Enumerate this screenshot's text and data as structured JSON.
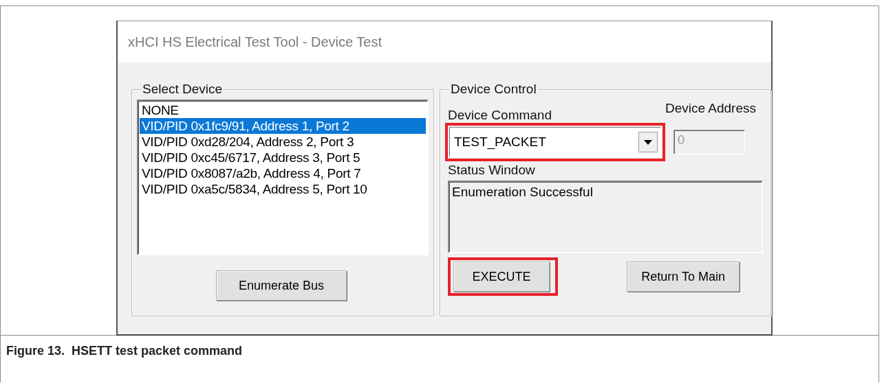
{
  "window": {
    "title": "xHCI HS Electrical Test Tool - Device Test"
  },
  "select_device": {
    "label": "Select Device",
    "items": [
      {
        "label": "NONE",
        "selected": false
      },
      {
        "label": "VID/PID 0x1fc9/91, Address 1, Port 2",
        "selected": true
      },
      {
        "label": "VID/PID 0xd28/204, Address 2, Port 3",
        "selected": false
      },
      {
        "label": "VID/PID 0xc45/6717, Address 3, Port 5",
        "selected": false
      },
      {
        "label": "VID/PID 0x8087/a2b, Address 4, Port 7",
        "selected": false
      },
      {
        "label": "VID/PID 0xa5c/5834, Address 5, Port 10",
        "selected": false
      }
    ],
    "button": {
      "label": "Enumerate Bus",
      "highlighted": false
    }
  },
  "device_control": {
    "label": "Device Control",
    "command_label": "Device Command",
    "command": {
      "value": "TEST_PACKET",
      "highlighted": true
    },
    "address_label": "Device Address",
    "address": {
      "value": "0",
      "disabled": true
    },
    "status_label": "Status Window",
    "status": "Enumeration Successful",
    "buttons": [
      {
        "label": "EXECUTE",
        "highlighted": true
      },
      {
        "label": "Return To Main",
        "highlighted": false
      }
    ]
  },
  "figure": {
    "caption": "Figure 13.  HSETT test packet command"
  }
}
